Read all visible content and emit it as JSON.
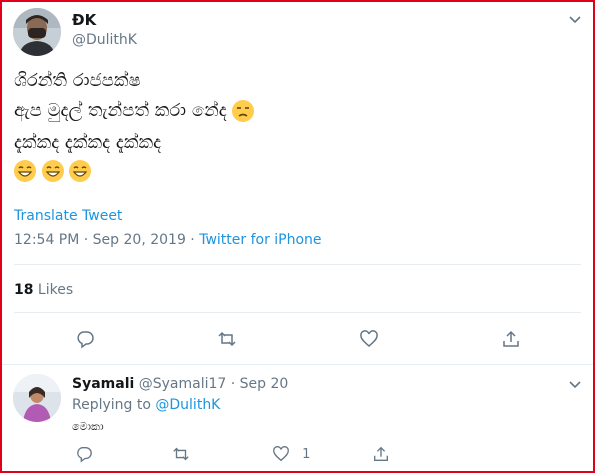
{
  "tweet": {
    "name": "ÐK",
    "handle": "@DulithK",
    "lines": [
      "ශිරන්ති රාජපක්ෂ",
      "ඇප මුදල් තැන්පත් කරා නේද",
      "දැක්කද දැක්කද දැක්කද"
    ],
    "translate": "Translate Tweet",
    "timestamp": "12:54 PM · Sep 20, 2019 · ",
    "source": "Twitter for iPhone",
    "likes_count": "18",
    "likes_label": " Likes"
  },
  "reply": {
    "name": "Syamali",
    "handle_time": " @Syamali17 · Sep 20",
    "replying_prefix": "Replying to ",
    "replying_to": "@DulithK",
    "text": "මොකා",
    "like_count": "1"
  },
  "colors": {
    "border": "#e0001b",
    "link": "#1b95e0",
    "muted": "#657786",
    "emoji": "#ffcc4d"
  },
  "icons": {
    "reply": "reply-icon",
    "retweet": "retweet-icon",
    "like": "heart-icon",
    "share": "share-icon",
    "caret": "chevron-down-icon"
  }
}
